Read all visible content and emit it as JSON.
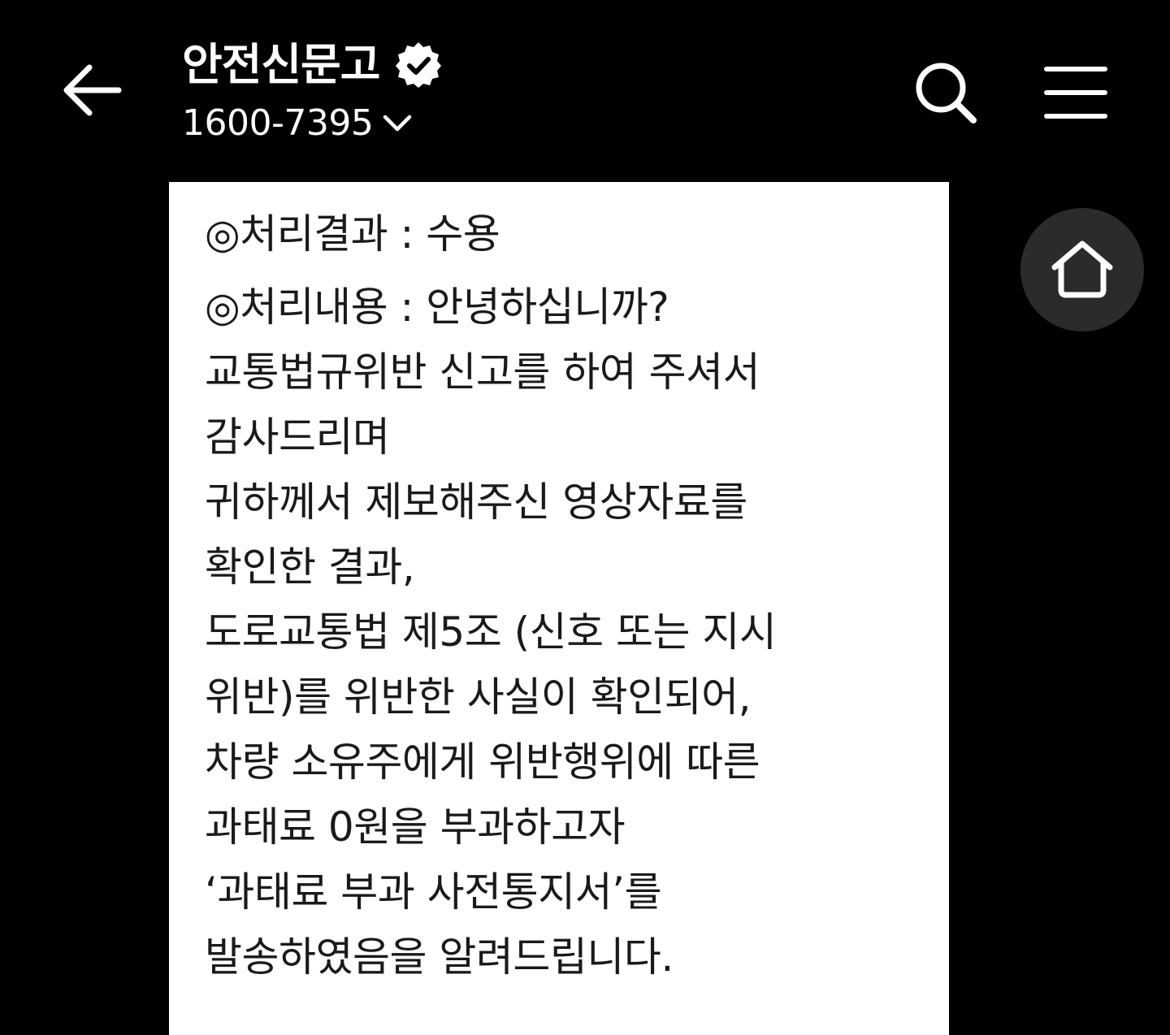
{
  "header": {
    "title": "안전신문고",
    "phone": "1600-7395",
    "icons": {
      "back": "arrow-left-icon",
      "verified": "verified-badge-icon",
      "phone_toggle": "chevron-down-icon",
      "search": "search-icon",
      "menu": "hamburger-menu-icon"
    }
  },
  "message": {
    "lines": [
      "◎처리결과 : 수용",
      "◎처리내용 : 안녕하십니까?",
      "교통법규위반 신고를 하여 주셔서",
      "감사드리며",
      "귀하께서 제보해주신 영상자료를",
      "확인한 결과,",
      "도로교통법 제5조 (신호 또는 지시",
      "위반)를 위반한 사실이 확인되어,",
      "차량 소유주에게 위반행위에 따른",
      "과태료 0원을 부과하고자",
      "‘과태료 부과 사전통지서’를",
      "발송하였음을 알려드립니다."
    ]
  },
  "fab": {
    "icon": "home-icon"
  },
  "colors": {
    "background": "#000000",
    "card": "#ffffff",
    "text_dark": "#1a1a1a",
    "text_light": "#ffffff",
    "fab_bg": "#2b2b2b"
  }
}
